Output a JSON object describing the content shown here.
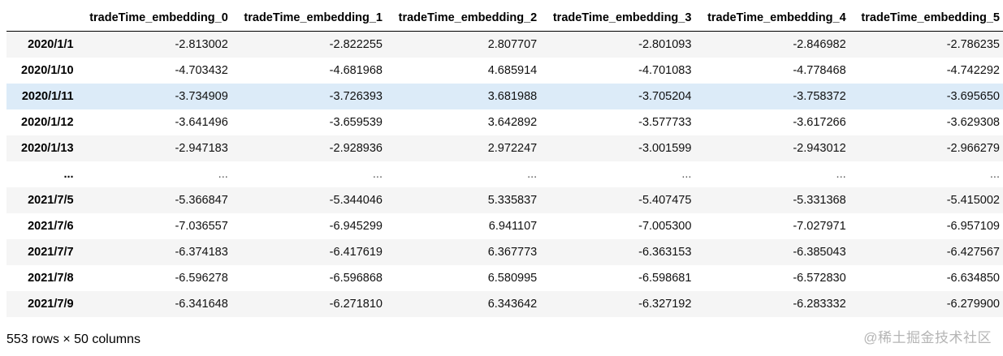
{
  "table": {
    "columns": [
      "tradeTime_embedding_0",
      "tradeTime_embedding_1",
      "tradeTime_embedding_2",
      "tradeTime_embedding_3",
      "tradeTime_embedding_4",
      "tradeTime_embedding_5"
    ],
    "rows": [
      {
        "index": "2020/1/1",
        "values": [
          "-2.813002",
          "-2.822255",
          "2.807707",
          "-2.801093",
          "-2.846982",
          "-2.786235"
        ]
      },
      {
        "index": "2020/1/10",
        "values": [
          "-4.703432",
          "-4.681968",
          "4.685914",
          "-4.701083",
          "-4.778468",
          "-4.742292"
        ]
      },
      {
        "index": "2020/1/11",
        "values": [
          "-3.734909",
          "-3.726393",
          "3.681988",
          "-3.705204",
          "-3.758372",
          "-3.695650"
        ]
      },
      {
        "index": "2020/1/12",
        "values": [
          "-3.641496",
          "-3.659539",
          "3.642892",
          "-3.577733",
          "-3.617266",
          "-3.629308"
        ]
      },
      {
        "index": "2020/1/13",
        "values": [
          "-2.947183",
          "-2.928936",
          "2.972247",
          "-3.001599",
          "-2.943012",
          "-2.966279"
        ]
      },
      {
        "index": "...",
        "values": [
          "...",
          "...",
          "...",
          "...",
          "...",
          "..."
        ]
      },
      {
        "index": "2021/7/5",
        "values": [
          "-5.366847",
          "-5.344046",
          "5.335837",
          "-5.407475",
          "-5.331368",
          "-5.415002"
        ]
      },
      {
        "index": "2021/7/6",
        "values": [
          "-7.036557",
          "-6.945299",
          "6.941107",
          "-7.005300",
          "-7.027971",
          "-6.957109"
        ]
      },
      {
        "index": "2021/7/7",
        "values": [
          "-6.374183",
          "-6.417619",
          "6.367773",
          "-6.363153",
          "-6.385043",
          "-6.427567"
        ]
      },
      {
        "index": "2021/7/8",
        "values": [
          "-6.596278",
          "-6.596868",
          "6.580995",
          "-6.598681",
          "-6.572830",
          "-6.634850"
        ]
      },
      {
        "index": "2021/7/9",
        "values": [
          "-6.341648",
          "-6.271810",
          "6.343642",
          "-6.327192",
          "-6.283332",
          "-6.279900"
        ]
      }
    ],
    "hovered_row_index": "2020/1/11"
  },
  "summary": "553 rows × 50 columns",
  "watermark": "@稀土掘金技术社区",
  "colors": {
    "row_stripe": "#f5f5f5",
    "row_hover": "#dcebf8",
    "header_rule": "#000000",
    "watermark": "#b5b5b5"
  }
}
